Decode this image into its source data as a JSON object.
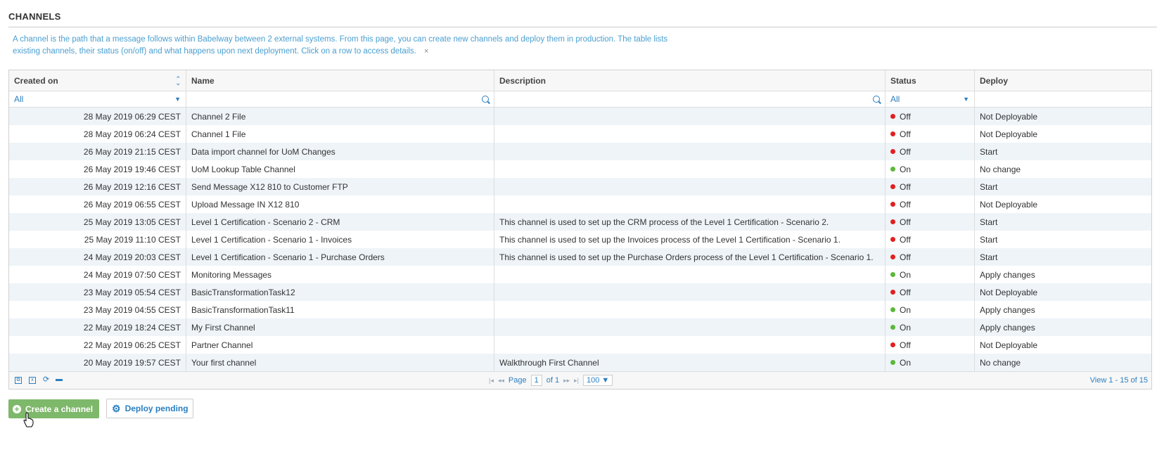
{
  "page": {
    "title": "CHANNELS",
    "intro": "A channel is the path that a message follows within Babelway between 2 external systems. From this page, you can create new channels and deploy them in production. The table lists existing channels, their status (on/off) and what happens upon next deployment. Click on a row to access details.",
    "close_glyph": "×"
  },
  "table": {
    "columns": [
      "Created on",
      "Name",
      "Description",
      "Status",
      "Deploy"
    ],
    "filters": {
      "created": "All",
      "status": "All"
    },
    "rows": [
      {
        "created": "28 May 2019 06:29 CEST",
        "name": "Channel 2 File",
        "description": "",
        "status": "Off",
        "deploy": "Not Deployable"
      },
      {
        "created": "28 May 2019 06:24 CEST",
        "name": "Channel 1 File",
        "description": "",
        "status": "Off",
        "deploy": "Not Deployable"
      },
      {
        "created": "26 May 2019 21:15 CEST",
        "name": "Data import channel for UoM Changes",
        "description": "",
        "status": "Off",
        "deploy": "Start"
      },
      {
        "created": "26 May 2019 19:46 CEST",
        "name": "UoM Lookup Table Channel",
        "description": "",
        "status": "On",
        "deploy": "No change"
      },
      {
        "created": "26 May 2019 12:16 CEST",
        "name": "Send Message X12 810 to Customer FTP",
        "description": "",
        "status": "Off",
        "deploy": "Start"
      },
      {
        "created": "26 May 2019 06:55 CEST",
        "name": "Upload Message IN X12 810",
        "description": "",
        "status": "Off",
        "deploy": "Not Deployable"
      },
      {
        "created": "25 May 2019 13:05 CEST",
        "name": "Level 1 Certification - Scenario 2 - CRM",
        "description": "This channel is used to set up the CRM process of the Level 1 Certification - Scenario 2.",
        "status": "Off",
        "deploy": "Start"
      },
      {
        "created": "25 May 2019 11:10 CEST",
        "name": "Level 1 Certification - Scenario 1 - Invoices",
        "description": "This channel is used to set up the Invoices process of the Level 1 Certification - Scenario 1.",
        "status": "Off",
        "deploy": "Start"
      },
      {
        "created": "24 May 2019 20:03 CEST",
        "name": "Level 1 Certification - Scenario 1 - Purchase Orders",
        "description": "This channel is used to set up the Purchase Orders process of the Level 1 Certification - Scenario 1.",
        "status": "Off",
        "deploy": "Start"
      },
      {
        "created": "24 May 2019 07:50 CEST",
        "name": "Monitoring Messages",
        "description": "",
        "status": "On",
        "deploy": "Apply changes"
      },
      {
        "created": "23 May 2019 05:54 CEST",
        "name": "BasicTransformationTask12",
        "description": "",
        "status": "Off",
        "deploy": "Not Deployable"
      },
      {
        "created": "23 May 2019 04:55 CEST",
        "name": "BasicTransformationTask11",
        "description": "",
        "status": "On",
        "deploy": "Apply changes"
      },
      {
        "created": "22 May 2019 18:24 CEST",
        "name": "My First Channel",
        "description": "",
        "status": "On",
        "deploy": "Apply changes"
      },
      {
        "created": "22 May 2019 06:25 CEST",
        "name": "Partner Channel",
        "description": "",
        "status": "Off",
        "deploy": "Not Deployable"
      },
      {
        "created": "20 May 2019 19:57 CEST",
        "name": "Your first channel",
        "description": "Walkthrough First Channel",
        "status": "On",
        "deploy": "No change"
      }
    ]
  },
  "pager": {
    "page_label": "Page",
    "page_value": "1",
    "of_label": "of 1",
    "rows_per_page": "100",
    "view_text": "View 1 - 15 of 15"
  },
  "buttons": {
    "create": "Create a channel",
    "deploy": "Deploy pending"
  },
  "colors": {
    "on": "#5bb83a",
    "off": "#e02020",
    "accent": "#2a7fc0",
    "create_bg": "#7eb86a"
  }
}
